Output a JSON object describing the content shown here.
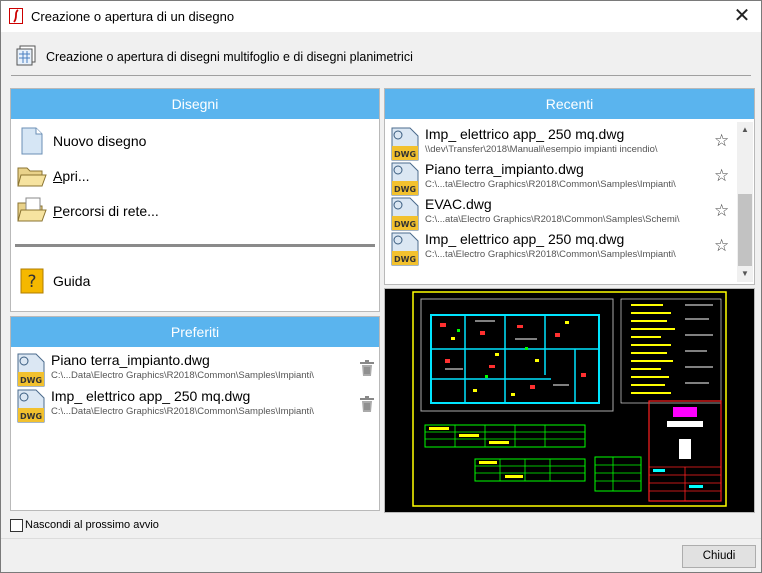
{
  "window": {
    "title": "Creazione o apertura di un disegno",
    "close_glyph": "✕"
  },
  "header": {
    "text": "Creazione o apertura di disegni multifoglio e di disegni planimetrici",
    "icon": "multisheet-drawing-icon"
  },
  "disegni": {
    "title": "Disegni",
    "nuovo": "Nuovo disegno",
    "apri_u": "A",
    "apri_rest": "pri...",
    "percorsi_u": "P",
    "percorsi_rest": "ercorsi di rete...",
    "guida": "Guida"
  },
  "preferiti": {
    "title": "Preferiti",
    "items": [
      {
        "name": "Piano terra_impianto.dwg",
        "path": "C:\\...Data\\Electro Graphics\\R2018\\Common\\Samples\\Impianti\\"
      },
      {
        "name": "Imp_ elettrico app_ 250 mq.dwg",
        "path": "C:\\...Data\\Electro Graphics\\R2018\\Common\\Samples\\Impianti\\"
      }
    ]
  },
  "recenti": {
    "title": "Recenti",
    "star_glyph": "☆",
    "items": [
      {
        "name": "Imp_ elettrico app_ 250 mq.dwg",
        "path": "\\\\dev\\Transfer\\2018\\Manuali\\esempio impianti incendio\\"
      },
      {
        "name": "Piano terra_impianto.dwg",
        "path": "C:\\...ta\\Electro Graphics\\R2018\\Common\\Samples\\Impianti\\"
      },
      {
        "name": "EVAC.dwg",
        "path": "C:\\...ata\\Electro Graphics\\R2018\\Common\\Samples\\Schemi\\"
      },
      {
        "name": "Imp_ elettrico app_ 250 mq.dwg",
        "path": "C:\\...ta\\Electro Graphics\\R2018\\Common\\Samples\\Impianti\\"
      }
    ]
  },
  "dwg_badge": "DWG",
  "scroll": {
    "up": "▲",
    "down": "▼"
  },
  "footer": {
    "checkbox_label": "Nascondi al prossimo avvio",
    "close_button": "Chiudi"
  },
  "colors": {
    "accent": "#5ab4ee",
    "dwg_yellow": "#f2c12e"
  }
}
